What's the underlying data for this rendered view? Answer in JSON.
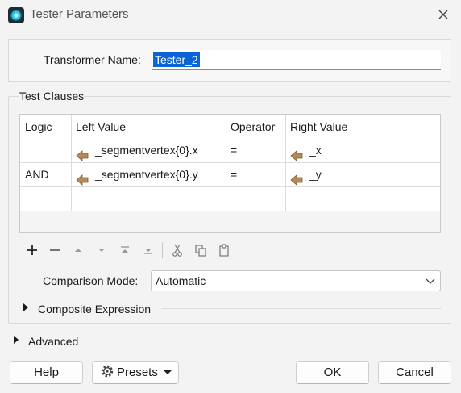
{
  "window": {
    "title": "Tester Parameters",
    "close_icon": "close-icon"
  },
  "transformer": {
    "label": "Transformer Name:",
    "value": "Tester_2"
  },
  "test_clauses": {
    "group_label": "Test Clauses",
    "columns": [
      "Logic",
      "Left Value",
      "Operator",
      "Right Value"
    ],
    "rows": [
      {
        "logic": "",
        "left": "_segmentvertex{0}.x",
        "operator": "=",
        "right": "_x"
      },
      {
        "logic": "AND",
        "left": "_segmentvertex{0}.y",
        "operator": "=",
        "right": "_y"
      },
      {
        "logic": "",
        "left": "",
        "operator": "",
        "right": ""
      }
    ],
    "toolbar": [
      "add-icon",
      "remove-icon",
      "move-up-icon",
      "move-down-icon",
      "move-top-icon",
      "move-bottom-icon",
      "cut-icon",
      "copy-icon",
      "paste-icon"
    ],
    "attribute_icon": "attribute-arrow-icon"
  },
  "comparison_mode": {
    "label": "Comparison Mode:",
    "value": "Automatic"
  },
  "composite_expression": {
    "label": "Composite Expression"
  },
  "advanced": {
    "label": "Advanced"
  },
  "buttons": {
    "help": "Help",
    "presets": "Presets",
    "ok": "OK",
    "cancel": "Cancel"
  },
  "colors": {
    "selection": "#0a64d6",
    "attribute_arrow": "#b48a58"
  }
}
